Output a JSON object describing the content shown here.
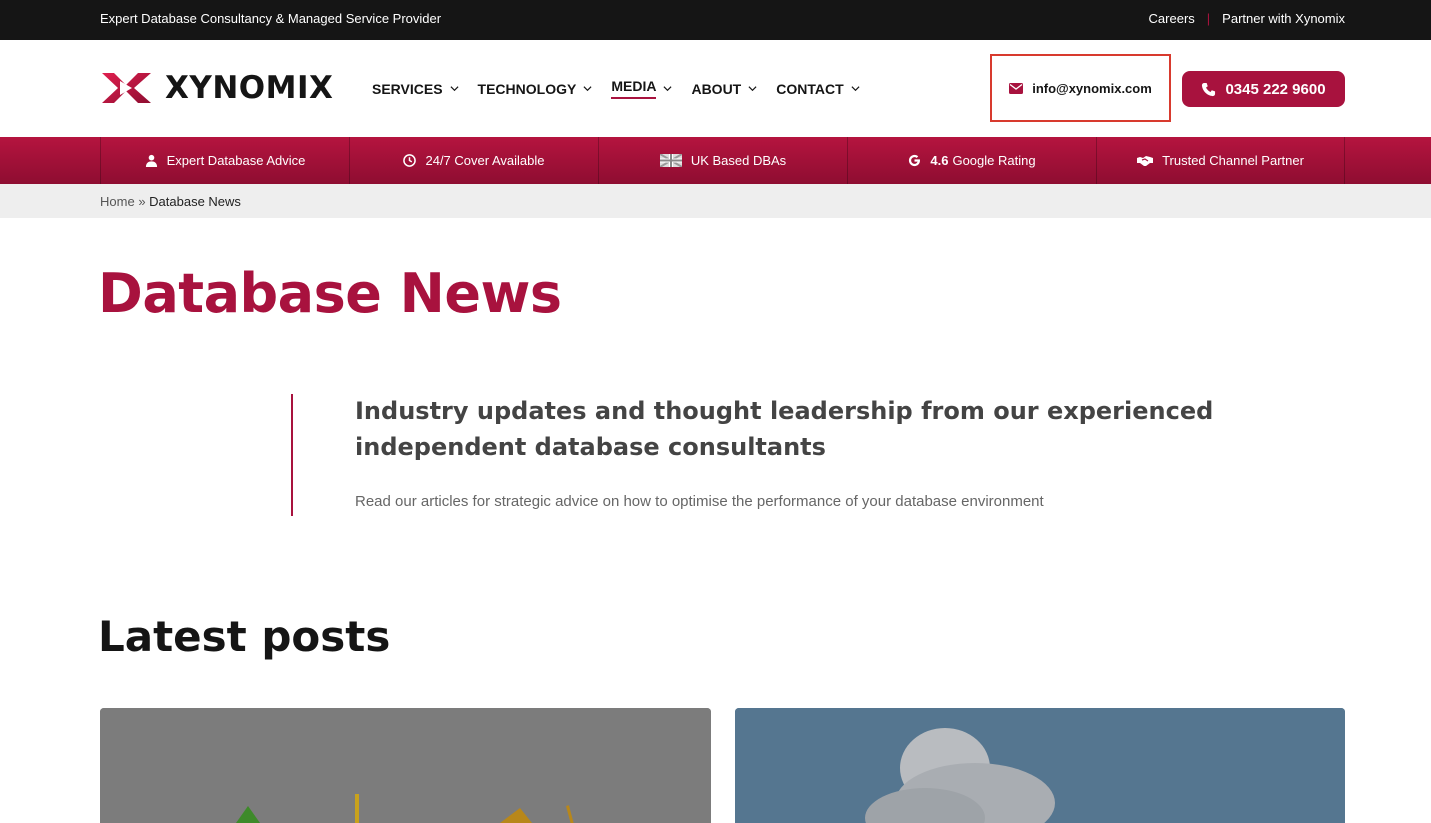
{
  "topbar": {
    "tagline": "Expert Database Consultancy & Managed Service Provider",
    "careers": "Careers",
    "separator": "|",
    "partner": "Partner with Xynomix"
  },
  "header": {
    "brand": "XYNOMIX",
    "nav": [
      {
        "label": "SERVICES",
        "active": false
      },
      {
        "label": "TECHNOLOGY",
        "active": false
      },
      {
        "label": "MEDIA",
        "active": true
      },
      {
        "label": "ABOUT",
        "active": false
      },
      {
        "label": "CONTACT",
        "active": false
      }
    ],
    "email": "info@xynomix.com",
    "phone": "0345 222 9600"
  },
  "usp": [
    {
      "icon": "user-icon",
      "bold": "",
      "label": "Expert Database Advice"
    },
    {
      "icon": "clock-icon",
      "bold": "",
      "label": "24/7 Cover Available"
    },
    {
      "icon": "uk-flag-icon",
      "bold": "",
      "label": "UK Based DBAs"
    },
    {
      "icon": "google-icon",
      "bold": "4.6",
      "label": "Google Rating"
    },
    {
      "icon": "handshake-icon",
      "bold": "",
      "label": "Trusted Channel Partner"
    }
  ],
  "breadcrumb": {
    "home": "Home",
    "separator": "»",
    "current": "Database News"
  },
  "main": {
    "title": "Database News",
    "intro_heading": "Industry updates and thought leadership from our experienced independent database consultants",
    "intro_text": "Read our articles for strategic advice on how to optimise the performance of your database environment",
    "latest_heading": "Latest posts"
  },
  "colors": {
    "brand": "#a8123e",
    "topbar": "#151515",
    "highlight_box": "#d83a2e"
  }
}
